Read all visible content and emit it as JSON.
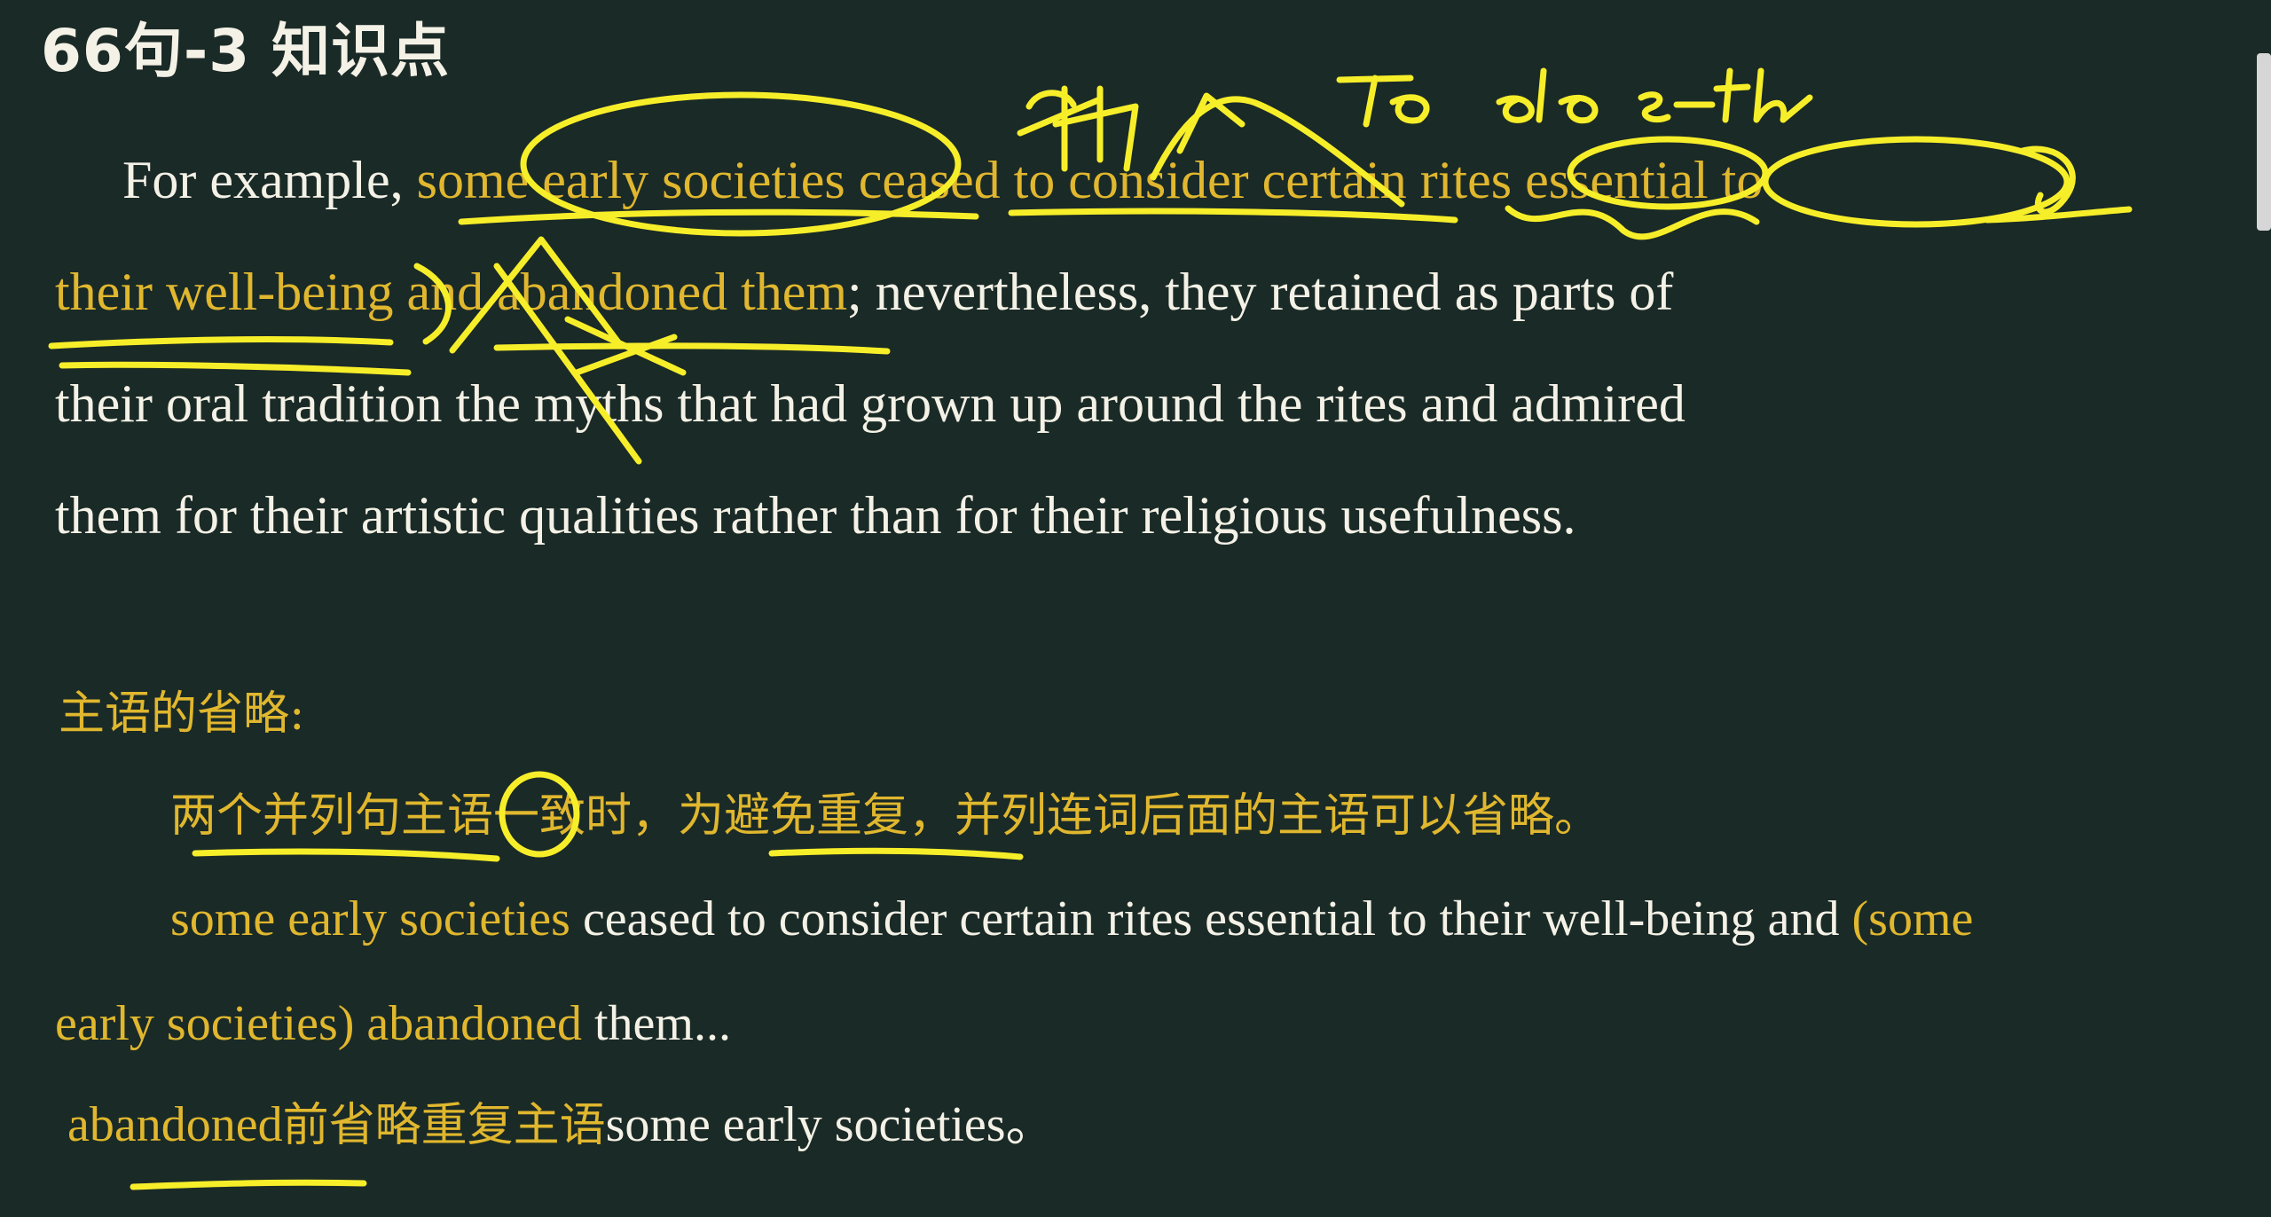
{
  "title": "66句-3 知识点",
  "passage": {
    "l1_a": "For example, ",
    "l1_b": "some early societies ceased to consider certain rites essential to",
    "l2_a": "their well-being",
    "l2_b": " and abandoned them",
    "l2_c": "; nevertheless, they retained as parts of",
    "l3": "their oral tradition the myths that had grown up around the rites and admired",
    "l4": "them for their artistic qualities rather than for their religious usefulness."
  },
  "explanation": {
    "label": "主语的省略:",
    "rule": "两个并列句主语一致时，为避免重复，并列连词后面的主语可以省略。",
    "example_subject": "some early societies",
    "example_mid": " ceased to consider certain rites essential to their well-being and ",
    "example_restored": "(some",
    "example_restored2": "early societies) abandoned",
    "example_tail": " them...",
    "note_a": "abandoned",
    "note_b": "前省略重复主语",
    "note_c": "some early societies",
    "note_d": "。"
  },
  "handwriting": [
    "泪",
    "to do s-th"
  ],
  "colors": {
    "background": "#1a2a27",
    "text": "#f4f1e6",
    "highlight": "#e0b72e",
    "ink": "#f7ee2a"
  }
}
